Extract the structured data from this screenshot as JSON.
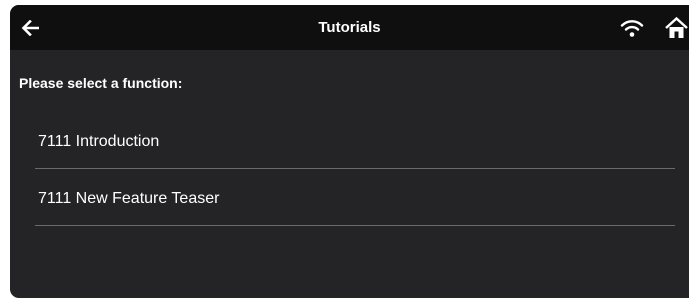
{
  "header": {
    "title": "Tutorials",
    "back_icon": "arrow-left-icon",
    "wifi_icon": "wifi-icon",
    "home_icon": "home-icon"
  },
  "main": {
    "prompt": "Please select a function:",
    "items": [
      {
        "label": "7111 Introduction"
      },
      {
        "label": "7111 New Feature Teaser"
      }
    ]
  },
  "colors": {
    "topbar": "#0f0f10",
    "background": "#242426",
    "divider": "#6a6a6c",
    "text": "#ffffff"
  }
}
